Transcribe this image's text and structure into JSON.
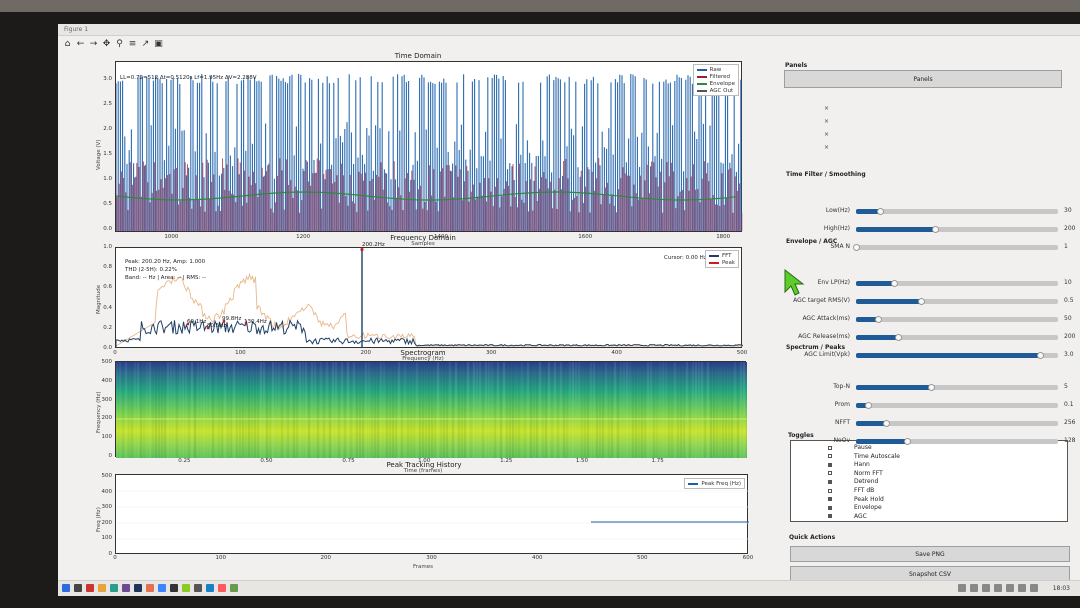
{
  "window": {
    "title": "Figure 1"
  },
  "toolbar": [
    {
      "name": "home-icon",
      "glyph": "⌂"
    },
    {
      "name": "back-icon",
      "glyph": "←"
    },
    {
      "name": "forward-icon",
      "glyph": "→"
    },
    {
      "name": "pan-icon",
      "glyph": "✥"
    },
    {
      "name": "zoom-icon",
      "glyph": "⚲"
    },
    {
      "name": "configure-icon",
      "glyph": "≡"
    },
    {
      "name": "edit-axes-icon",
      "glyph": "↗"
    },
    {
      "name": "save-icon",
      "glyph": "▣"
    }
  ],
  "time_domain": {
    "title": "Time Domain",
    "ylabel": "Voltage (V)",
    "info": "LL=0.72=512  Δt=0.5120s  Lf=1.95Hz  ΔV=2.288V",
    "yticks": [
      "3.0",
      "2.5",
      "2.0",
      "1.5",
      "1.0",
      "0.5",
      "0.0"
    ],
    "xticks": [
      "1000",
      "1200",
      "1400",
      "1600",
      "1800"
    ],
    "xlabel": "Samples",
    "legend": [
      {
        "label": "Raw",
        "color": "#1f5ea8"
      },
      {
        "label": "Filtered",
        "color": "#9c1b3a"
      },
      {
        "label": "Envelope",
        "color": "#2b8a3e"
      },
      {
        "label": "AGC Out",
        "color": "#555555"
      }
    ]
  },
  "frequency_domain": {
    "title": "Frequency Domain",
    "ylabel": "Magnitude",
    "info_lines": [
      "Peak: 200.20 Hz, Amp: 1.000",
      "THD (2-5H): 0.22%",
      "Band: -- Hz | Area: -- | RMS: --"
    ],
    "cursor": "Cursor: 0.00 Hz",
    "peak_label": "200.2Hz",
    "small_peaks": [
      "60.1Hz",
      "80.5Hz",
      "99.8Hz",
      "130.4Hz"
    ],
    "yticks": [
      "1.0",
      "0.8",
      "0.6",
      "0.4",
      "0.2",
      "0.0"
    ],
    "xticks": [
      "0",
      "100",
      "200",
      "300",
      "400",
      "500"
    ],
    "xlabel": "Frequency (Hz)",
    "legend": [
      {
        "label": "FFT",
        "color": "#1f3f66"
      },
      {
        "label": "Peak",
        "color": "#d11a1a"
      }
    ]
  },
  "spectrogram": {
    "title": "Spectrogram",
    "ylabel": "Frequency (Hz)",
    "yticks": [
      "500",
      "400",
      "300",
      "200",
      "100",
      "0"
    ],
    "xticks": [
      "0.25",
      "0.50",
      "0.75",
      "1.00",
      "1.25",
      "1.50",
      "1.75"
    ],
    "xlabel": "Time (frames)"
  },
  "peak_history": {
    "title": "Peak Tracking History",
    "ylabel": "Freq (Hz)",
    "yticks": [
      "500",
      "400",
      "300",
      "200",
      "100",
      "0"
    ],
    "xticks": [
      "0",
      "100",
      "200",
      "300",
      "400",
      "500",
      "600"
    ],
    "xlabel": "Frames",
    "legend": [
      {
        "label": "Peak Freq (Hz)",
        "color": "#1f5ea8"
      }
    ]
  },
  "panel": {
    "panels_title": "Panels",
    "panels_button": "Panels",
    "x_marks": [
      "×",
      "×",
      "×",
      "×"
    ],
    "time_filter_title": "Time Filter / Smoothing",
    "time_filter": [
      {
        "label": "Low(Hz)",
        "fill": 0.12,
        "value": "30"
      },
      {
        "label": "High(Hz)",
        "fill": 0.39,
        "value": "200"
      },
      {
        "label": "SMA N",
        "fill": 0.0,
        "value": "1"
      }
    ],
    "envelope_title": "Envelope / AGC",
    "envelope": [
      {
        "label": "Env LP(Hz)",
        "fill": 0.19,
        "value": "10"
      },
      {
        "label": "AGC target RMS(V)",
        "fill": 0.32,
        "value": "0.5"
      },
      {
        "label": "AGC Attack(ms)",
        "fill": 0.11,
        "value": "50"
      },
      {
        "label": "AGC Release(ms)",
        "fill": 0.21,
        "value": "200"
      },
      {
        "label": "AGC Limit(Vpk)",
        "fill": 0.91,
        "value": "3.0"
      }
    ],
    "spectrum_title": "Spectrum / Peaks",
    "spectrum": [
      {
        "label": "Top-N",
        "fill": 0.37,
        "value": "5"
      },
      {
        "label": "Prom",
        "fill": 0.06,
        "value": "0.1"
      },
      {
        "label": "NFFT",
        "fill": 0.15,
        "value": "256"
      },
      {
        "label": "NoOv",
        "fill": 0.25,
        "value": "128"
      }
    ],
    "toggles_title": "Toggles",
    "toggles": [
      {
        "label": "Pause",
        "on": false
      },
      {
        "label": "Time Autoscale",
        "on": false
      },
      {
        "label": "Hann",
        "on": true
      },
      {
        "label": "Norm FFT",
        "on": false
      },
      {
        "label": "Detrend",
        "on": true
      },
      {
        "label": "FFT dB",
        "on": false
      },
      {
        "label": "Peak Hold",
        "on": true
      },
      {
        "label": "Envelope",
        "on": true
      },
      {
        "label": "AGC",
        "on": true
      }
    ],
    "quick_actions_title": "Quick Actions",
    "save_png": "Save PNG",
    "snapshot_csv": "Snapshot CSV"
  },
  "taskbar": {
    "time": "18:03"
  }
}
